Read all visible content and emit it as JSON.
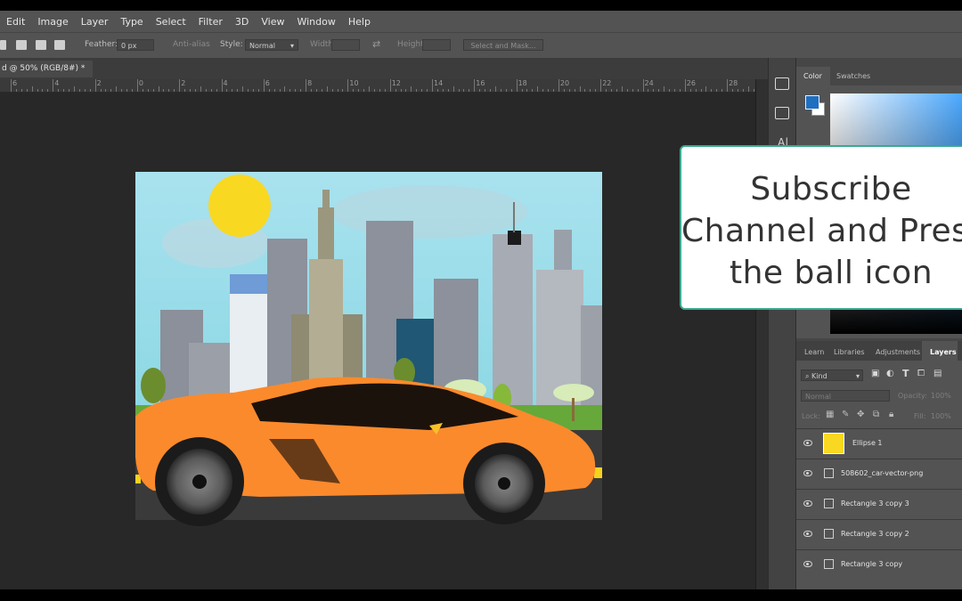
{
  "menu": [
    "Edit",
    "Image",
    "Layer",
    "Type",
    "Select",
    "Filter",
    "3D",
    "View",
    "Window",
    "Help"
  ],
  "options": {
    "feather_label": "Feather:",
    "feather_value": "0 px",
    "antialias_label": "Anti-alias",
    "style_label": "Style:",
    "style_value": "Normal",
    "width_label": "Width:",
    "height_label": "Height:",
    "select_mask": "Select and Mask..."
  },
  "document_tab": {
    "title": "d @ 50% (RGB/8#) *",
    "close": "×"
  },
  "ruler": [
    "6",
    "4",
    "2",
    "0",
    "2",
    "4",
    "6",
    "8",
    "10",
    "12",
    "14",
    "16",
    "18",
    "20",
    "22",
    "24",
    "26",
    "28"
  ],
  "color_panel": {
    "tabs": [
      "Color",
      "Swatches"
    ],
    "foreground": "#1f6fc0"
  },
  "panel_tabs": [
    "Learn",
    "Libraries",
    "Adjustments",
    "Layers"
  ],
  "layers_panel": {
    "filter_kind": "Kind",
    "blend_mode": "Normal",
    "opacity_label": "Opacity:",
    "opacity_value": "100%",
    "lock_label": "Lock:",
    "fill_label": "Fill:",
    "fill_value": "100%",
    "layers": [
      {
        "name": "Ellipse 1",
        "thumb": "ellipse"
      },
      {
        "name": "508602_car-vector-png",
        "thumb": "smart"
      },
      {
        "name": "Rectangle 3 copy 3",
        "thumb": "shape"
      },
      {
        "name": "Rectangle 3 copy 2",
        "thumb": "shape"
      },
      {
        "name": "Rectangle 3 copy",
        "thumb": "shape"
      }
    ]
  },
  "overlay": {
    "lines": [
      "Subscribe",
      "Channel and Press",
      "the ball icon"
    ]
  },
  "colors": {
    "sun": "#f9d821",
    "car": "#fb8a2c",
    "sky": "#9adbe8",
    "grass": "#66a83a"
  }
}
